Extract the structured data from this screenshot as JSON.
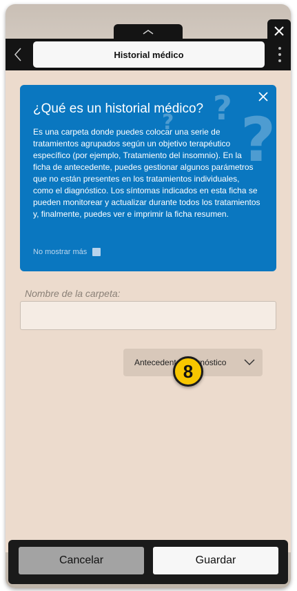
{
  "header": {
    "title": "Historial médico"
  },
  "info_card": {
    "title": "¿Qué es un historial médico?",
    "body": "Es una carpeta donde puedes colocar una serie de tratamientos agrupados según un objetivo terapéutico específico (por ejemplo, Tratamiento del insomnio). En la ficha de antecedente, puedes gestionar algunos parámetros que no están presentes en los tratamientos individuales, como el diagnóstico. Los síntomas indicados en esta ficha se pueden monitorear y actualizar durante todos los tratamientos y, finalmente, puedes ver e imprimir la ficha resumen.",
    "no_show_label": "No mostrar más",
    "accent_color": "#0a77c0"
  },
  "form": {
    "folder_name_label": "Nombre de la carpeta:",
    "folder_name_value": "",
    "dropdown_selected": "Antecedente/Diagnóstico"
  },
  "badge": {
    "number": "8",
    "color": "#f7c600"
  },
  "footer": {
    "cancel_label": "Cancelar",
    "save_label": "Guardar"
  },
  "icons": [
    "chevron-up-icon",
    "close-icon",
    "back-arrow-icon",
    "more-vertical-icon",
    "chevron-down-icon",
    "question-mark-icon"
  ]
}
